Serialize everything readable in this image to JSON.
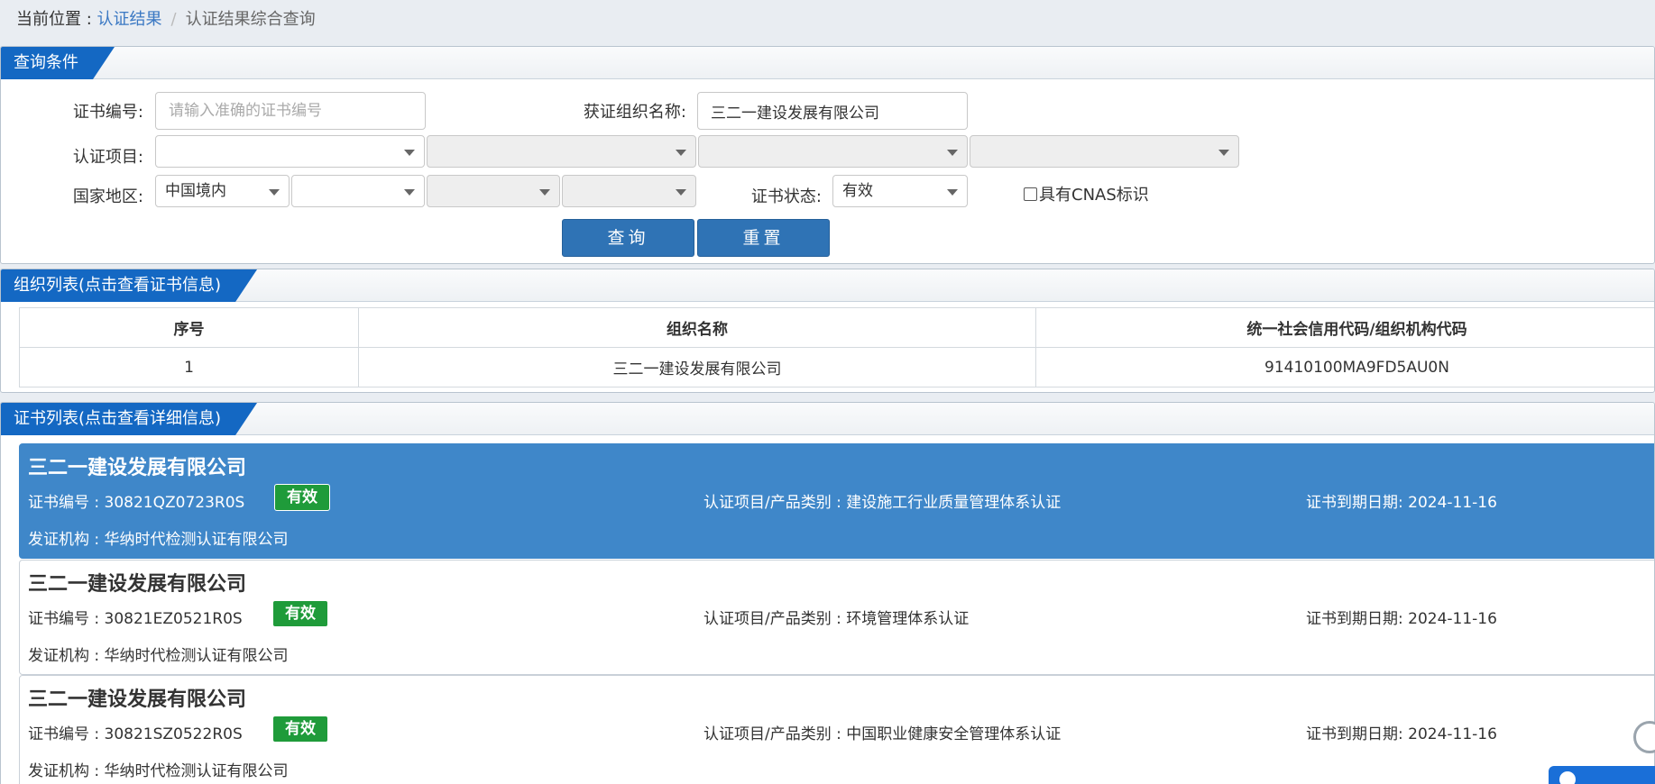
{
  "breadcrumb": {
    "prefix": "当前位置 : ",
    "link": "认证结果",
    "separator": "/",
    "current": "认证结果综合查询"
  },
  "query": {
    "title": "查询条件",
    "cert_no_label": "证书编号:",
    "cert_no_placeholder": "请输入准确的证书编号",
    "cert_no_value": "",
    "org_name_label": "获证组织名称:",
    "org_name_value": "三二一建设发展有限公司",
    "project_label": "认证项目:",
    "region_label": "国家地区:",
    "region_selected": "中国境内",
    "status_label": "证书状态:",
    "status_selected": "有效",
    "cnas_label": "具有CNAS标识",
    "search_button": "查询",
    "reset_button": "重置"
  },
  "org_list": {
    "title": "组织列表(点击查看证书信息)",
    "headers": [
      "序号",
      "组织名称",
      "统一社会信用代码/组织机构代码"
    ],
    "rows": [
      [
        "1",
        "三二一建设发展有限公司",
        "91410100MA9FD5AU0N"
      ]
    ]
  },
  "cert_list": {
    "title": "证书列表(点击查看详细信息)",
    "items": [
      {
        "org": "三二一建设发展有限公司",
        "cert_no": "证书编号 : 30821QZ0723R0S",
        "status": "有效",
        "project": "认证项目/产品类别 : 建设施工行业质量管理体系认证",
        "expiry": "证书到期日期: 2024-11-16",
        "issuer": "发证机构 : 华纳时代检测认证有限公司"
      },
      {
        "org": "三二一建设发展有限公司",
        "cert_no": "证书编号 : 30821EZ0521R0S",
        "status": "有效",
        "project": "认证项目/产品类别 : 环境管理体系认证",
        "expiry": "证书到期日期: 2024-11-16",
        "issuer": "发证机构 : 华纳时代检测认证有限公司"
      },
      {
        "org": "三二一建设发展有限公司",
        "cert_no": "证书编号 : 30821SZ0522R0S",
        "status": "有效",
        "project": "认证项目/产品类别 : 中国职业健康安全管理体系认证",
        "expiry": "证书到期日期: 2024-11-16",
        "issuer": "发证机构 : 华纳时代检测认证有限公司"
      }
    ]
  },
  "colors": {
    "accent": "#1468c3",
    "active_row": "#3f87c9",
    "valid_badge": "#1f9b3a",
    "button": "#2f73b5"
  }
}
